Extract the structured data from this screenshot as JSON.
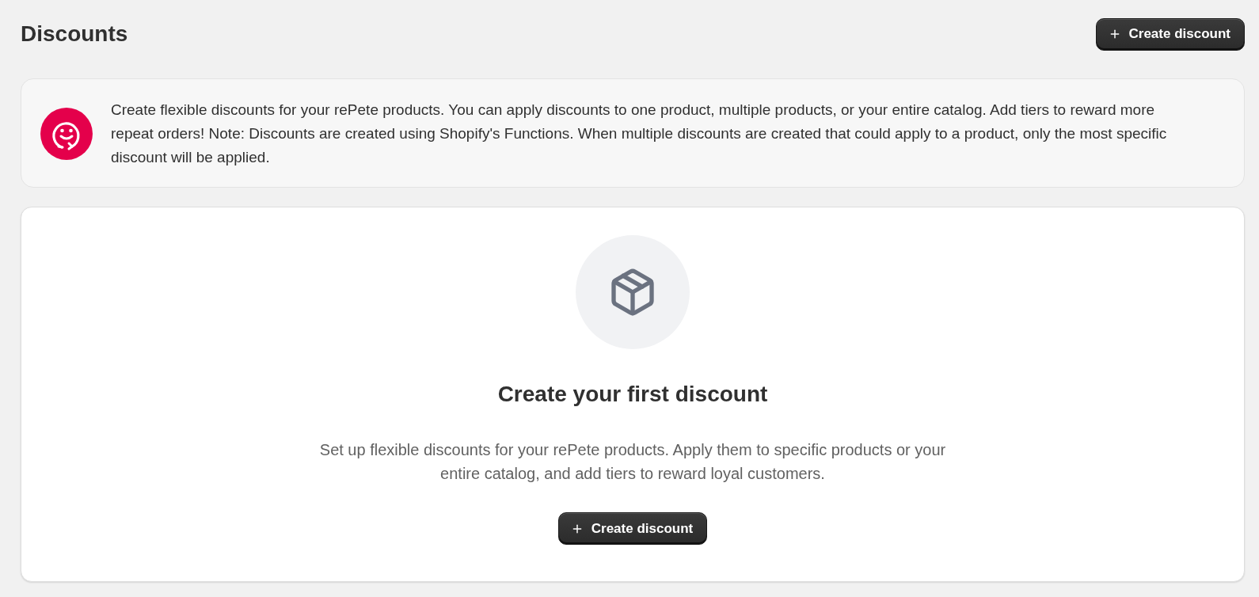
{
  "page": {
    "title": "Discounts",
    "primary_action": {
      "label": "Create discount"
    }
  },
  "banner": {
    "text": "Create flexible discounts for your rePete products. You can apply discounts to one product, multiple products, or your entire catalog. Add tiers to reward more repeat orders! Note: Discounts are created using Shopify's Functions. When multiple discounts are created that could apply to a product, only the most specific discount will be applied."
  },
  "empty_state": {
    "heading": "Create your first discount",
    "description": "Set up flexible discounts for your rePete products. Apply them to specific products or your entire catalog, and add tiers to reward loyal customers.",
    "action": {
      "label": "Create discount"
    }
  }
}
